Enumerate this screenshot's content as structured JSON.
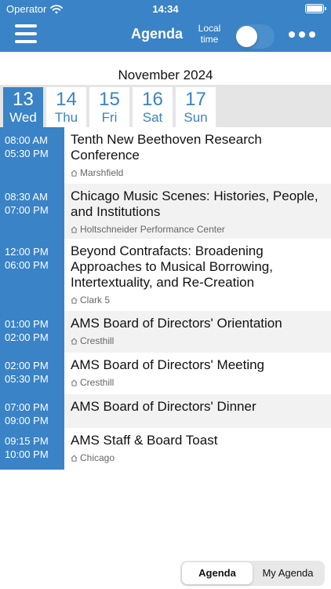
{
  "status": {
    "carrier": "Operator",
    "time": "14:34"
  },
  "nav": {
    "title": "Agenda",
    "local_time_label": "Local time",
    "local_time_on": false
  },
  "month": "November 2024",
  "dates": [
    {
      "day": "13",
      "weekday": "Wed",
      "selected": true
    },
    {
      "day": "14",
      "weekday": "Thu",
      "selected": false
    },
    {
      "day": "15",
      "weekday": "Fri",
      "selected": false
    },
    {
      "day": "16",
      "weekday": "Sat",
      "selected": false
    },
    {
      "day": "17",
      "weekday": "Sun",
      "selected": false
    }
  ],
  "events": [
    {
      "start": "08:00 AM",
      "end": "05:30 PM",
      "title": "Tenth New Beethoven Research Conference",
      "location": "Marshfield"
    },
    {
      "start": "08:30 AM",
      "end": "07:00 PM",
      "title": "Chicago Music Scenes: Histories, People, and Institutions",
      "location": "Holtschneider Performance Center"
    },
    {
      "start": "12:00 PM",
      "end": "06:00 PM",
      "title": "Beyond Contrafacts: Broadening Approaches to Musical Borrowing, Intertextuality, and Re-Creation",
      "location": "Clark 5"
    },
    {
      "start": "01:00 PM",
      "end": "02:00 PM",
      "title": "AMS Board of Directors' Orientation",
      "location": "Cresthill"
    },
    {
      "start": "02:00 PM",
      "end": "05:30 PM",
      "title": "AMS Board of Directors' Meeting",
      "location": "Cresthill"
    },
    {
      "start": "07:00 PM",
      "end": "09:00 PM",
      "title": "AMS Board of Directors' Dinner",
      "location": ""
    },
    {
      "start": "09:15 PM",
      "end": "10:00 PM",
      "title": "AMS Staff & Board Toast",
      "location": "Chicago"
    }
  ],
  "segments": {
    "agenda": "Agenda",
    "my_agenda": "My Agenda",
    "active": "agenda"
  },
  "colors": {
    "accent": "#3a83c6",
    "alt_row": "#f2f2f2",
    "strip": "#e5e5e5"
  },
  "icons": {
    "menu": "hamburger-icon",
    "more": "more-dots-icon",
    "location": "home-icon",
    "wifi": "wifi-icon",
    "battery": "battery-icon"
  }
}
